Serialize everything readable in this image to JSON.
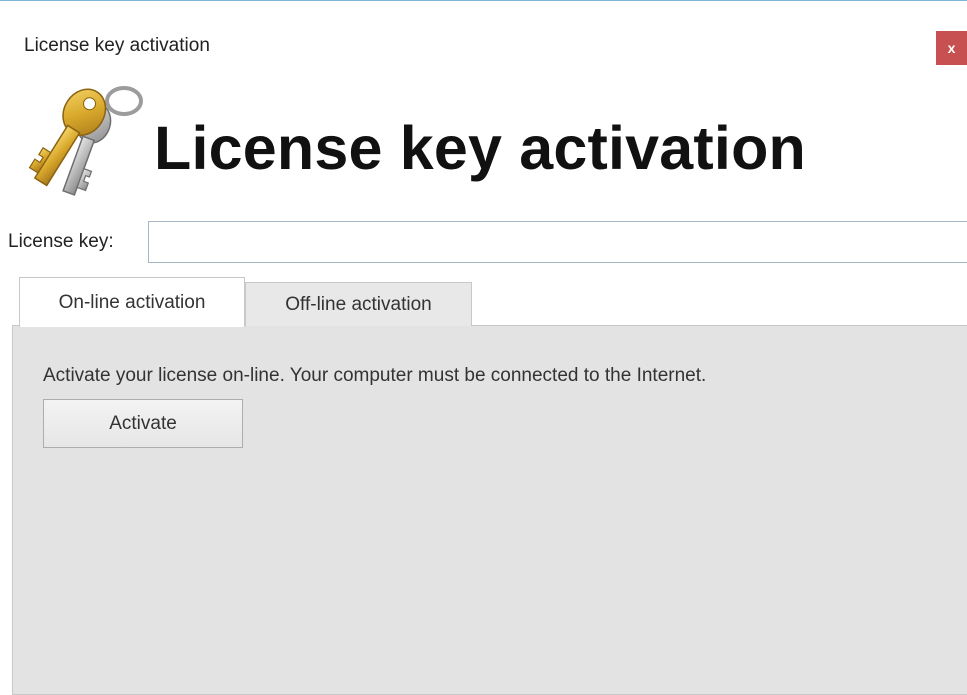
{
  "window": {
    "title": "License key activation",
    "close_label": "x"
  },
  "header": {
    "icon": "keys-icon",
    "heading": "License key activation"
  },
  "license_key": {
    "label": "License key:",
    "value": "",
    "placeholder": ""
  },
  "tabs": [
    {
      "label": "On-line activation",
      "selected": true
    },
    {
      "label": "Off-line activation",
      "selected": false
    }
  ],
  "online_panel": {
    "description": "Activate your license on-line. Your computer must be connected to the Internet.",
    "activate_label": "Activate"
  },
  "colors": {
    "close_button": "#c75050",
    "panel_background": "#e3e3e3",
    "window_border": "#7fb6d9"
  }
}
